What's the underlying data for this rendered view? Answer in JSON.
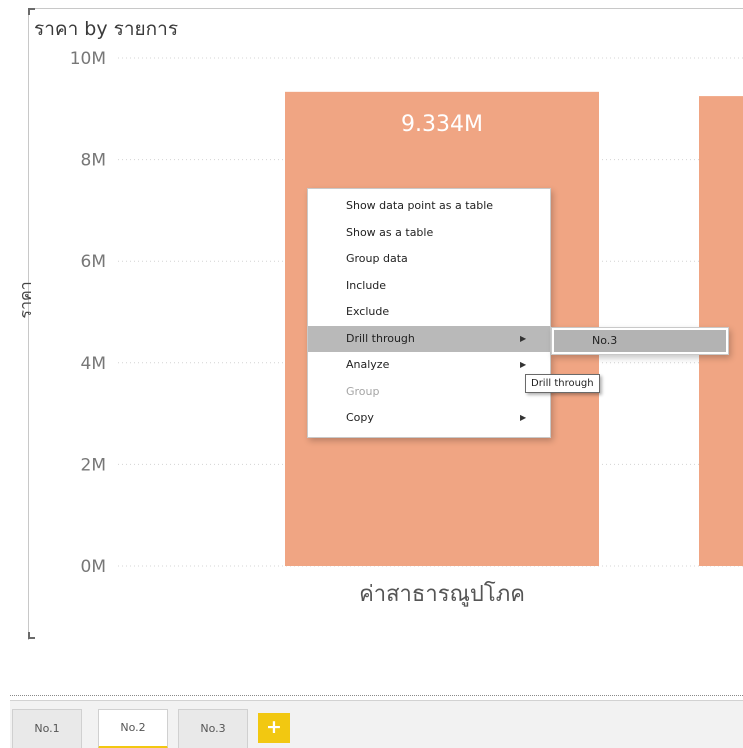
{
  "chart_data": {
    "type": "bar",
    "title": "ราคา by รายการ",
    "xlabel": "",
    "ylabel": "ราคา",
    "categories": [
      "ค่าสาธารณูปโภค",
      ""
    ],
    "values": [
      9334000,
      9250000
    ],
    "data_labels": [
      "9.334M"
    ],
    "y_ticks": [
      "0M",
      "2M",
      "4M",
      "6M",
      "8M",
      "10M"
    ],
    "ylim": [
      0,
      10000000
    ],
    "grid": true,
    "bar_color": "#f0a583"
  },
  "context_menu": {
    "items": [
      {
        "label": "Show data point as a table",
        "disabled": false,
        "highlighted": false,
        "submenu": false
      },
      {
        "label": "Show as a table",
        "disabled": false,
        "highlighted": false,
        "submenu": false
      },
      {
        "label": "Group data",
        "disabled": false,
        "highlighted": false,
        "submenu": false
      },
      {
        "label": "Include",
        "disabled": false,
        "highlighted": false,
        "submenu": false
      },
      {
        "label": "Exclude",
        "disabled": false,
        "highlighted": false,
        "submenu": false
      },
      {
        "label": "Drill through",
        "disabled": false,
        "highlighted": true,
        "submenu": true
      },
      {
        "label": "Analyze",
        "disabled": false,
        "highlighted": false,
        "submenu": true
      },
      {
        "label": "Group",
        "disabled": true,
        "highlighted": false,
        "submenu": false
      },
      {
        "label": "Copy",
        "disabled": false,
        "highlighted": false,
        "submenu": true
      }
    ],
    "submenu_arrow": "▶"
  },
  "drill_through_submenu": {
    "items": [
      {
        "label": "No.3"
      }
    ]
  },
  "tooltip": {
    "text": "Drill through"
  },
  "page_tabs": {
    "tabs": [
      {
        "label": "No.1",
        "active": false
      },
      {
        "label": "No.2",
        "active": true
      },
      {
        "label": "No.3",
        "active": false
      }
    ],
    "add_label": "+"
  },
  "colors": {
    "accent": "#f2c811",
    "bar": "#f0a583",
    "highlight": "#b9b9b9"
  }
}
